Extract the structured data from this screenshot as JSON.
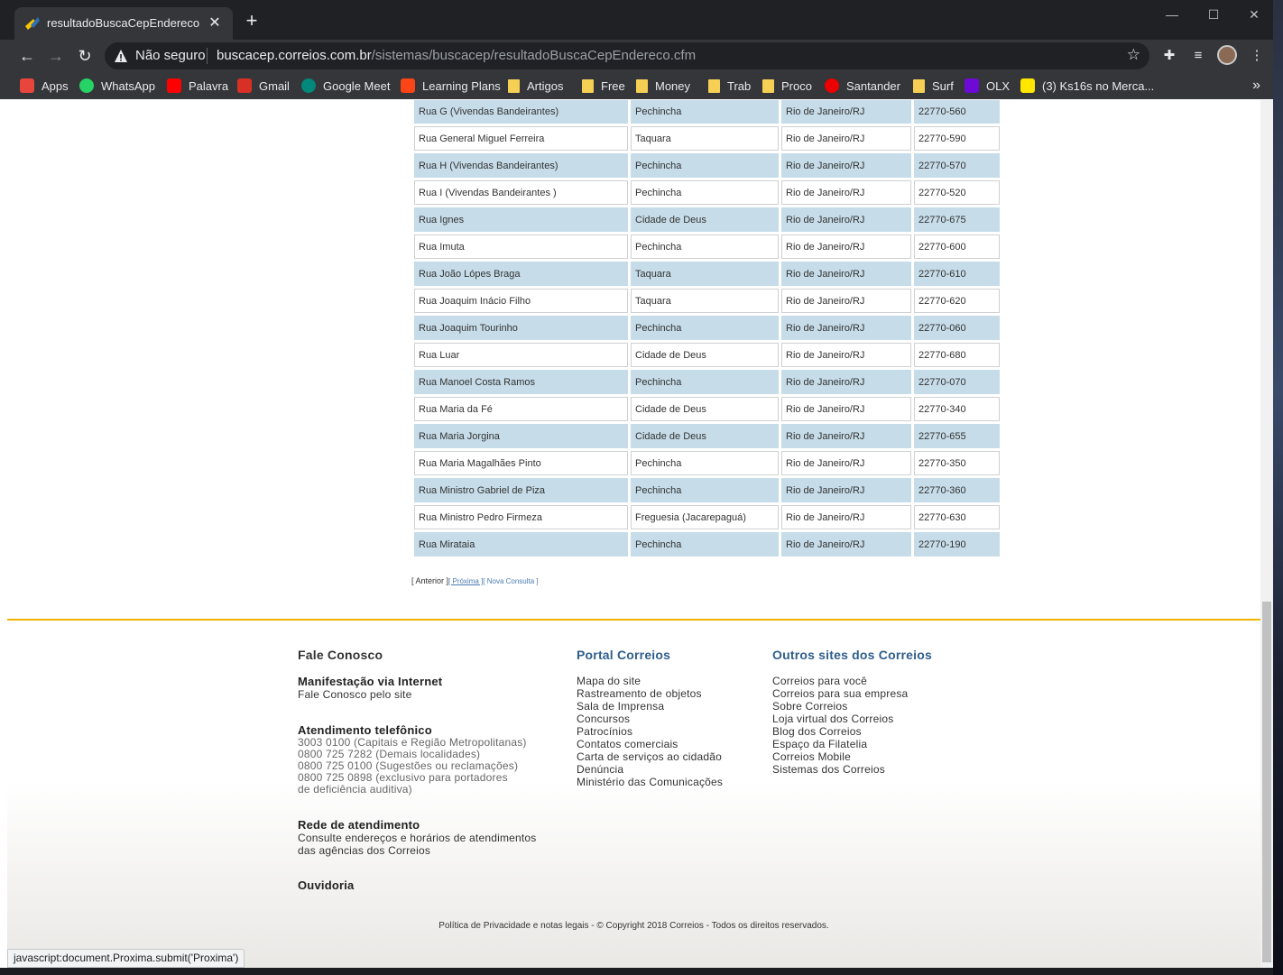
{
  "browser": {
    "tab_title": "resultadoBuscaCepEndereco",
    "tab_close": "✕",
    "new_tab": "+",
    "security_label": "Não seguro",
    "url_host": "buscacep.correios.com.br",
    "url_path": "/sistemas/buscacep/resultadoBuscaCepEndereco.cfm",
    "status_text": "javascript:document.Proxima.submit('Proxima')"
  },
  "bookmarks": [
    {
      "label": "Apps",
      "icon": "apps-grid-icon",
      "color": "#e8453c"
    },
    {
      "label": "WhatsApp",
      "icon": "whatsapp-icon",
      "color": "#25d366"
    },
    {
      "label": "Palavra",
      "icon": "youtube-icon",
      "color": "#ff0000"
    },
    {
      "label": "Gmail",
      "icon": "gmail-icon",
      "color": "#d93025"
    },
    {
      "label": "Google Meet",
      "icon": "meet-icon",
      "color": "#00897b"
    },
    {
      "label": "Learning Plans",
      "icon": "uipath-icon",
      "color": "#fa4616"
    },
    {
      "label": "Artigos",
      "icon": "folder-icon",
      "color": "#f6cf55"
    },
    {
      "label": "Free",
      "icon": "folder-icon",
      "color": "#f6cf55"
    },
    {
      "label": "Money",
      "icon": "folder-icon",
      "color": "#f6cf55"
    },
    {
      "label": "Trab",
      "icon": "folder-icon",
      "color": "#f6cf55"
    },
    {
      "label": "Proco",
      "icon": "folder-icon",
      "color": "#f6cf55"
    },
    {
      "label": "Santander",
      "icon": "santander-icon",
      "color": "#ec0000"
    },
    {
      "label": "Surf",
      "icon": "folder-icon",
      "color": "#f6cf55"
    },
    {
      "label": "OLX",
      "icon": "olx-icon",
      "color": "#6e0ad6"
    },
    {
      "label": "(3) Ks16s no Merca...",
      "icon": "mercadolivre-icon",
      "color": "#ffe600"
    }
  ],
  "results": [
    {
      "logradouro": "Rua G (Vivendas Bandeirantes)",
      "bairro": "Pechincha",
      "localidade": "Rio de Janeiro/RJ",
      "cep": "22770-560"
    },
    {
      "logradouro": "Rua General Miguel Ferreira",
      "bairro": "Taquara",
      "localidade": "Rio de Janeiro/RJ",
      "cep": "22770-590"
    },
    {
      "logradouro": "Rua H (Vivendas Bandeirantes)",
      "bairro": "Pechincha",
      "localidade": "Rio de Janeiro/RJ",
      "cep": "22770-570"
    },
    {
      "logradouro": "Rua I (Vivendas Bandeirantes )",
      "bairro": "Pechincha",
      "localidade": "Rio de Janeiro/RJ",
      "cep": "22770-520"
    },
    {
      "logradouro": "Rua Ignes",
      "bairro": "Cidade de Deus",
      "localidade": "Rio de Janeiro/RJ",
      "cep": "22770-675"
    },
    {
      "logradouro": "Rua Imuta",
      "bairro": "Pechincha",
      "localidade": "Rio de Janeiro/RJ",
      "cep": "22770-600"
    },
    {
      "logradouro": "Rua João Lópes Braga",
      "bairro": "Taquara",
      "localidade": "Rio de Janeiro/RJ",
      "cep": "22770-610"
    },
    {
      "logradouro": "Rua Joaquim Inácio Filho",
      "bairro": "Taquara",
      "localidade": "Rio de Janeiro/RJ",
      "cep": "22770-620"
    },
    {
      "logradouro": "Rua Joaquim Tourinho",
      "bairro": "Pechincha",
      "localidade": "Rio de Janeiro/RJ",
      "cep": "22770-060"
    },
    {
      "logradouro": "Rua Luar",
      "bairro": "Cidade de Deus",
      "localidade": "Rio de Janeiro/RJ",
      "cep": "22770-680"
    },
    {
      "logradouro": "Rua Manoel Costa Ramos",
      "bairro": "Pechincha",
      "localidade": "Rio de Janeiro/RJ",
      "cep": "22770-070"
    },
    {
      "logradouro": "Rua Maria da Fé",
      "bairro": "Cidade de Deus",
      "localidade": "Rio de Janeiro/RJ",
      "cep": "22770-340"
    },
    {
      "logradouro": "Rua Maria Jorgina",
      "bairro": "Cidade de Deus",
      "localidade": "Rio de Janeiro/RJ",
      "cep": "22770-655"
    },
    {
      "logradouro": "Rua Maria Magalhães Pinto",
      "bairro": "Pechincha",
      "localidade": "Rio de Janeiro/RJ",
      "cep": "22770-350"
    },
    {
      "logradouro": "Rua Ministro Gabriel de Piza",
      "bairro": "Pechincha",
      "localidade": "Rio de Janeiro/RJ",
      "cep": "22770-360"
    },
    {
      "logradouro": "Rua Ministro Pedro Firmeza",
      "bairro": "Freguesia (Jacarepaguá)",
      "localidade": "Rio de Janeiro/RJ",
      "cep": "22770-630"
    },
    {
      "logradouro": "Rua Mirataia",
      "bairro": "Pechincha",
      "localidade": "Rio de Janeiro/RJ",
      "cep": "22770-190"
    }
  ],
  "pager": {
    "anterior": "[ Anterior ]",
    "proxima": "[ Próxima ]",
    "nova_consulta": "[ Nova Consulta ]"
  },
  "footer": {
    "fale": {
      "title": "Fale Conosco",
      "manif_title": "Manifestação via Internet",
      "manif_link": "Fale Conosco pelo site",
      "tel_title": "Atendimento telefônico",
      "tel_lines": [
        "3003 0100 (Capitais e Região Metropolitanas)",
        "0800 725 7282 (Demais localidades)",
        "0800 725 0100 (Sugestões ou reclamações)",
        "0800 725 0898 (exclusivo para portadores",
        "de deficiência auditiva)"
      ],
      "rede_title": "Rede de atendimento",
      "rede_lines": [
        "Consulte endereços e horários de atendimentos",
        "das agências dos Correios"
      ],
      "ouvidoria": "Ouvidoria"
    },
    "portal": {
      "title": "Portal Correios",
      "links": [
        "Mapa do site",
        "Rastreamento de objetos",
        "Sala de Imprensa",
        "Concursos",
        "Patrocínios",
        "Contatos comerciais",
        "Carta de serviços ao cidadão",
        "Denúncia",
        "Ministério das Comunicações"
      ]
    },
    "outros": {
      "title": "Outros sites dos Correios",
      "links": [
        "Correios para você",
        "Correios para sua empresa",
        "Sobre Correios",
        "Loja virtual dos Correios",
        "Blog dos Correios",
        "Espaço da Filatelia",
        "Correios Mobile",
        "Sistemas dos Correios"
      ]
    },
    "copyright": "Política de Privacidade e notas legais - © Copyright 2018 Correios - Todos os direitos reservados."
  }
}
